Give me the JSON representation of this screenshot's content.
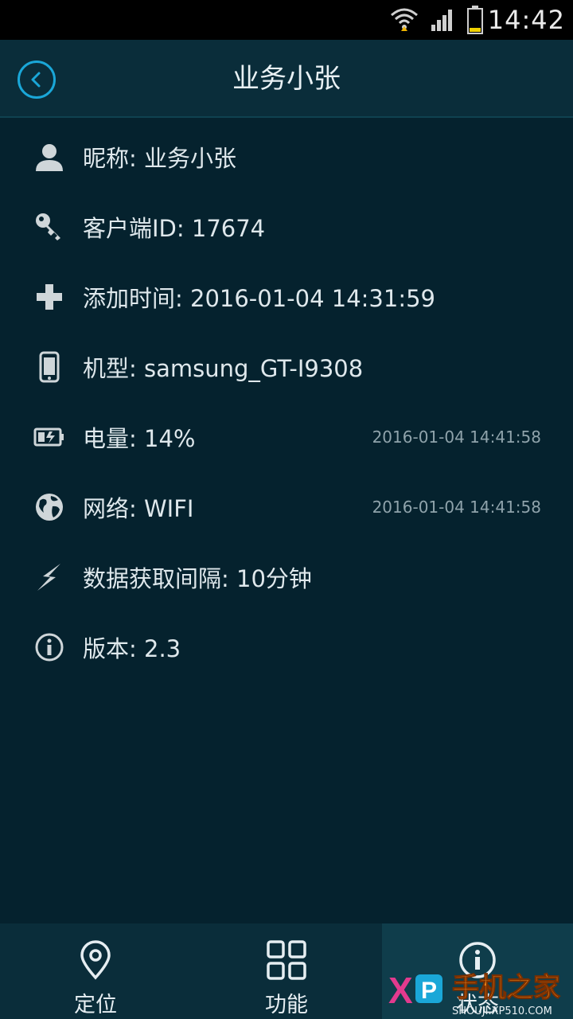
{
  "status_bar": {
    "time": "14:42"
  },
  "header": {
    "title": "业务小张",
    "back_icon": "chevron-left-icon"
  },
  "info": {
    "items": [
      {
        "icon": "user-icon",
        "label": "昵称:  业务小张",
        "timestamp": ""
      },
      {
        "icon": "key-icon",
        "label": "客户端ID:  17674",
        "timestamp": ""
      },
      {
        "icon": "plus-icon",
        "label": "添加时间:  2016-01-04 14:31:59",
        "timestamp": ""
      },
      {
        "icon": "phone-icon",
        "label": "机型:  samsung_GT-I9308",
        "timestamp": ""
      },
      {
        "icon": "battery-icon",
        "label": "电量:  14%",
        "timestamp": "2016-01-04 14:41:58"
      },
      {
        "icon": "globe-icon",
        "label": "网络:  WIFI",
        "timestamp": "2016-01-04 14:41:58"
      },
      {
        "icon": "lightning-icon",
        "label": "数据获取间隔:  10分钟",
        "timestamp": ""
      },
      {
        "icon": "info-icon",
        "label": "版本:  2.3",
        "timestamp": ""
      }
    ]
  },
  "bottom_nav": {
    "items": [
      {
        "icon": "location-pin-icon",
        "label": "定位"
      },
      {
        "icon": "grid-icon",
        "label": "功能"
      },
      {
        "icon": "info-icon",
        "label": "状态"
      }
    ]
  },
  "watermark": {
    "brand": "手机之家",
    "url": "SHOUJI.XP510.COM"
  },
  "colors": {
    "background": "#05222e",
    "header": "#0a2d3a",
    "accent": "#1aa7d8"
  }
}
